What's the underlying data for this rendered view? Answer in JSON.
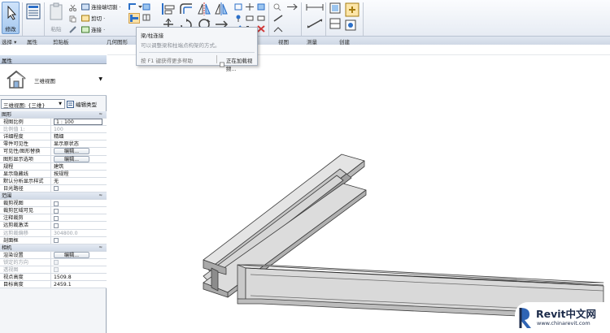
{
  "ribbon": {
    "modify_label": "修改",
    "panels": {
      "select": "选择 ▾",
      "properties": "属性",
      "clipboard": "剪贴板",
      "geometry": "几何图形",
      "view": "视图",
      "measure": "测量",
      "create": "创建"
    },
    "paste_label": "粘贴",
    "properties_btn": "属性",
    "clipboard_items": {
      "cut": "剪切 ·",
      "join": "连接 ·"
    },
    "geometry_items": {
      "cope": "连接端切割 ·"
    }
  },
  "tooltip": {
    "title": "梁/柱连接",
    "description": "可以调整梁和柱端点构架的方式。",
    "help_hint": "按 F1 键获得更多帮助",
    "loading": "正在加载视频..."
  },
  "properties": {
    "header": "属性",
    "type_name": "三维视图",
    "instance_selector": "三维视图: {三维}",
    "edit_type": "编辑类型",
    "rows": [
      {
        "kind": "cat",
        "label": "图形",
        "chevron": "≈"
      },
      {
        "label": "视图比例",
        "value": "1 : 100",
        "ctl": "box"
      },
      {
        "label": "比例值 1:",
        "value": "100",
        "dis": true
      },
      {
        "label": "详细程度",
        "value": "精细"
      },
      {
        "label": "零件可见性",
        "value": "显示原状态"
      },
      {
        "label": "可见性/图形替换",
        "value": "编辑...",
        "ctl": "btn"
      },
      {
        "label": "图形显示选项",
        "value": "编辑...",
        "ctl": "btn"
      },
      {
        "label": "规程",
        "value": "建筑"
      },
      {
        "label": "显示隐藏线",
        "value": "按规程"
      },
      {
        "label": "默认分析显示样式",
        "value": "无"
      },
      {
        "label": "日光路径",
        "value": "",
        "ctl": "cb"
      },
      {
        "kind": "cat",
        "label": "范围",
        "chevron": "≈"
      },
      {
        "label": "裁剪视图",
        "value": "",
        "ctl": "cb"
      },
      {
        "label": "裁剪区域可见",
        "value": "",
        "ctl": "cb"
      },
      {
        "label": "注释裁剪",
        "value": "",
        "ctl": "cb"
      },
      {
        "label": "远剪裁激活",
        "value": "",
        "ctl": "cb"
      },
      {
        "label": "远剪裁偏移",
        "value": "304800.0",
        "dis": true
      },
      {
        "label": "剖面框",
        "value": "",
        "ctl": "cb"
      },
      {
        "kind": "cat",
        "label": "相机",
        "chevron": "≈"
      },
      {
        "label": "渲染设置",
        "value": "编辑...",
        "ctl": "btn"
      },
      {
        "label": "锁定的方向",
        "value": "",
        "ctl": "cbd",
        "dis": true
      },
      {
        "label": "透视图",
        "value": "",
        "ctl": "cbd",
        "dis": true
      },
      {
        "label": "视点高度",
        "value": "1509.8"
      },
      {
        "label": "目标高度",
        "value": "2459.1"
      }
    ]
  },
  "watermark": {
    "brand": "Revit中文网",
    "url": "www.chinarevit.com"
  },
  "colors": {
    "ribbon_bg": "#e2e8f1",
    "accent_blue": "#2b6fc8",
    "steel_face": "#d2d2d2",
    "steel_edge": "#3c3c3c"
  }
}
